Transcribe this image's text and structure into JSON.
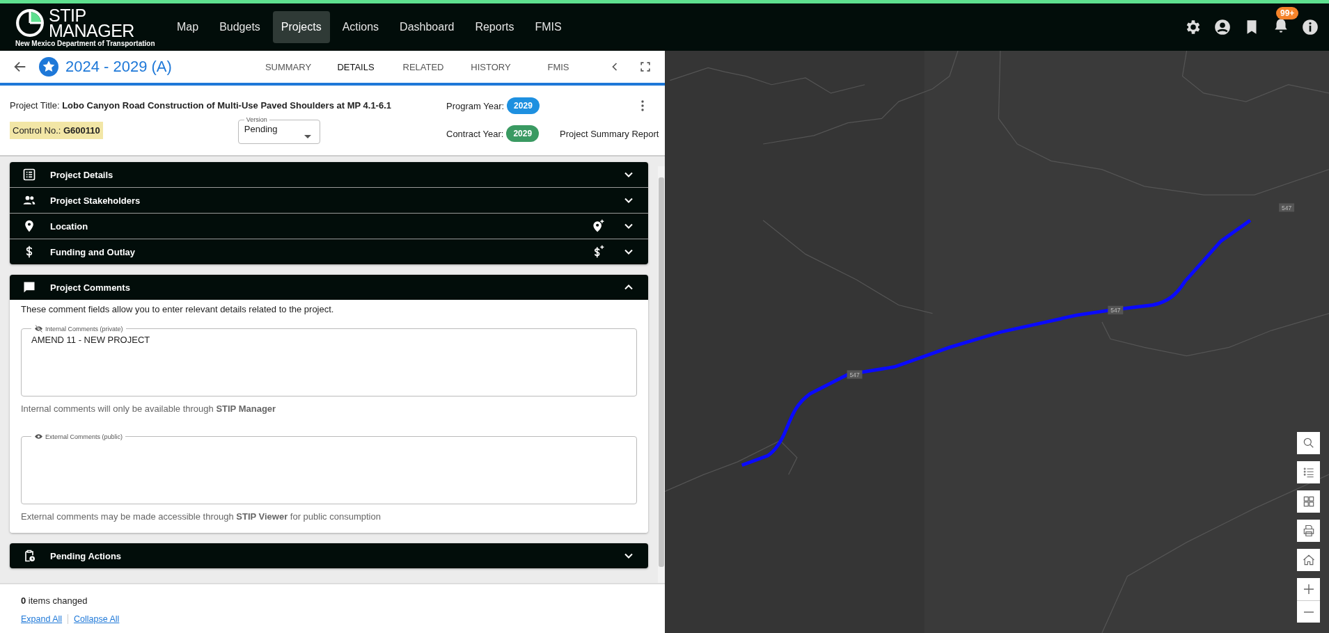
{
  "header": {
    "logo_line_1": "STIP",
    "logo_line_2": "MANAGER",
    "logo_subtitle": "New Mexico Department of Transportation",
    "nav": [
      {
        "label": "Map",
        "selected": false
      },
      {
        "label": "Budgets",
        "selected": false
      },
      {
        "label": "Projects",
        "selected": true
      },
      {
        "label": "Actions",
        "selected": false
      },
      {
        "label": "Dashboard",
        "selected": false
      },
      {
        "label": "Reports",
        "selected": false
      },
      {
        "label": "FMIS",
        "selected": false
      }
    ],
    "notification_badge": "99+"
  },
  "project_bar": {
    "title": "2024 - 2029 (A)",
    "tabs": [
      {
        "label": "SUMMARY",
        "selected": false
      },
      {
        "label": "DETAILS",
        "selected": true
      },
      {
        "label": "RELATED",
        "selected": false
      },
      {
        "label": "HISTORY",
        "selected": false
      },
      {
        "label": "FMIS",
        "selected": false
      }
    ]
  },
  "project_info": {
    "title_label": "Project Title:",
    "title": "Lobo Canyon Road Construction of Multi-Use Paved Shoulders at MP 4.1-6.1",
    "control_label": "Control No.:",
    "control_no": "G600110",
    "version_label": "Version",
    "version": "Pending",
    "years": [
      {
        "label": "Program Year:",
        "value": "2029",
        "color": "#1e90e0"
      },
      {
        "label": "Contract Year:",
        "value": "2029",
        "color": "#3a9a62"
      }
    ],
    "report_link": "Project Summary Report"
  },
  "section_groups": [
    [
      {
        "kind": "details",
        "title": "Project Details",
        "expanded": false
      },
      {
        "kind": "stakeholders",
        "title": "Project Stakeholders",
        "expanded": false
      },
      {
        "kind": "location",
        "title": "Location",
        "expanded": false
      },
      {
        "kind": "funding",
        "title": "Funding and Outlay",
        "expanded": false
      }
    ],
    [
      {
        "kind": "comments",
        "title": "Project Comments",
        "expanded": true,
        "intro": "These comment fields allow you to enter relevant details related to the project.",
        "fields": [
          {
            "kind": "private",
            "label": "Internal Comments (private)",
            "value": "AMEND 11 - NEW PROJECT",
            "helper": "Internal comments will only be available through **STIP Manager**"
          },
          {
            "kind": "public",
            "label": "External Comments (public)",
            "helper": "External comments may be made accessible through **STIP Viewer** for public consumption"
          }
        ]
      }
    ],
    [
      {
        "kind": "pending",
        "title": "Pending Actions",
        "expanded": false
      }
    ]
  ],
  "footer": {
    "changed_count": "0",
    "changed_text": "items changed",
    "links": [
      "Expand All",
      "Collapse All"
    ]
  },
  "map": {
    "route_labels": [
      "547",
      "547",
      "547"
    ]
  }
}
